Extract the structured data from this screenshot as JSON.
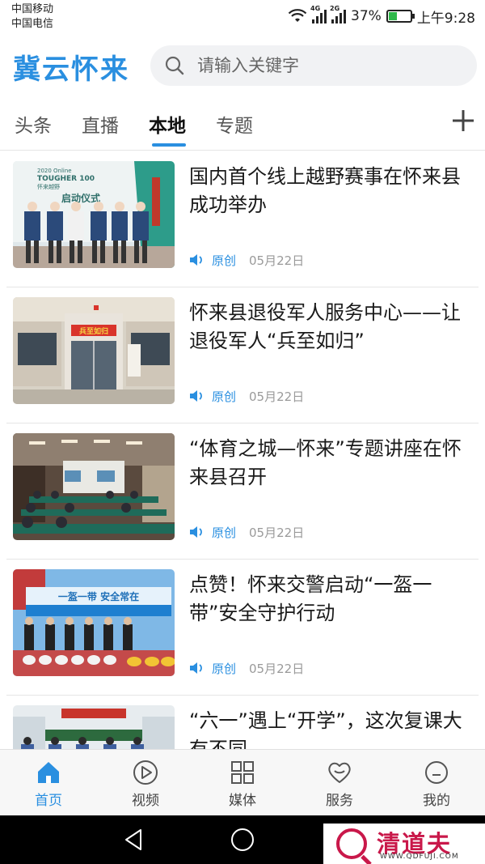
{
  "status_bar": {
    "carrier_1": "中国移动",
    "carrier_2": "中国电信",
    "network_1": "4G",
    "network_2": "2G",
    "battery_percent": "37%",
    "battery_level": 0.37,
    "time": "上午9:28"
  },
  "header": {
    "app_title": "冀云怀来",
    "search_placeholder": "请输入关键字"
  },
  "tabs": [
    {
      "label": "头条",
      "active": false
    },
    {
      "label": "直播",
      "active": false
    },
    {
      "label": "本地",
      "active": true
    },
    {
      "label": "专题",
      "active": false
    }
  ],
  "news": [
    {
      "title": "国内首个线上越野赛事在怀来县成功举办",
      "tag": "原创",
      "date": "05月22日",
      "thumb_text": [
        "2020 Online",
        "TOUGHER 100",
        "怀来越野",
        "启动仪式"
      ]
    },
    {
      "title": "怀来县退役军人服务中心——让退役军人“兵至如归”",
      "tag": "原创",
      "date": "05月22日",
      "thumb_text": [
        "兵至如归"
      ]
    },
    {
      "title": "“体育之城—怀来”专题讲座在怀来县召开",
      "tag": "原创",
      "date": "05月22日",
      "thumb_text": []
    },
    {
      "title": "点赞！怀来交警启动“一盔一带”安全守护行动",
      "tag": "原创",
      "date": "05月22日",
      "thumb_text": [
        "一盔一带  安全常在"
      ]
    },
    {
      "title": "“六一”遇上“开学”，这次复课大有不同",
      "tag": "",
      "date": "",
      "thumb_text": []
    }
  ],
  "bottom_nav": [
    {
      "label": "首页",
      "icon": "home-icon",
      "active": true
    },
    {
      "label": "视频",
      "icon": "play-icon",
      "active": false
    },
    {
      "label": "媒体",
      "icon": "grid-icon",
      "active": false
    },
    {
      "label": "服务",
      "icon": "heart-icon",
      "active": false
    },
    {
      "label": "我的",
      "icon": "smiley-icon",
      "active": false
    }
  ],
  "watermark": {
    "brand": "清道夫",
    "url": "WWW.QDFUJI.COM"
  },
  "colors": {
    "accent": "#2a8fe0",
    "watermark": "#c9184a"
  }
}
